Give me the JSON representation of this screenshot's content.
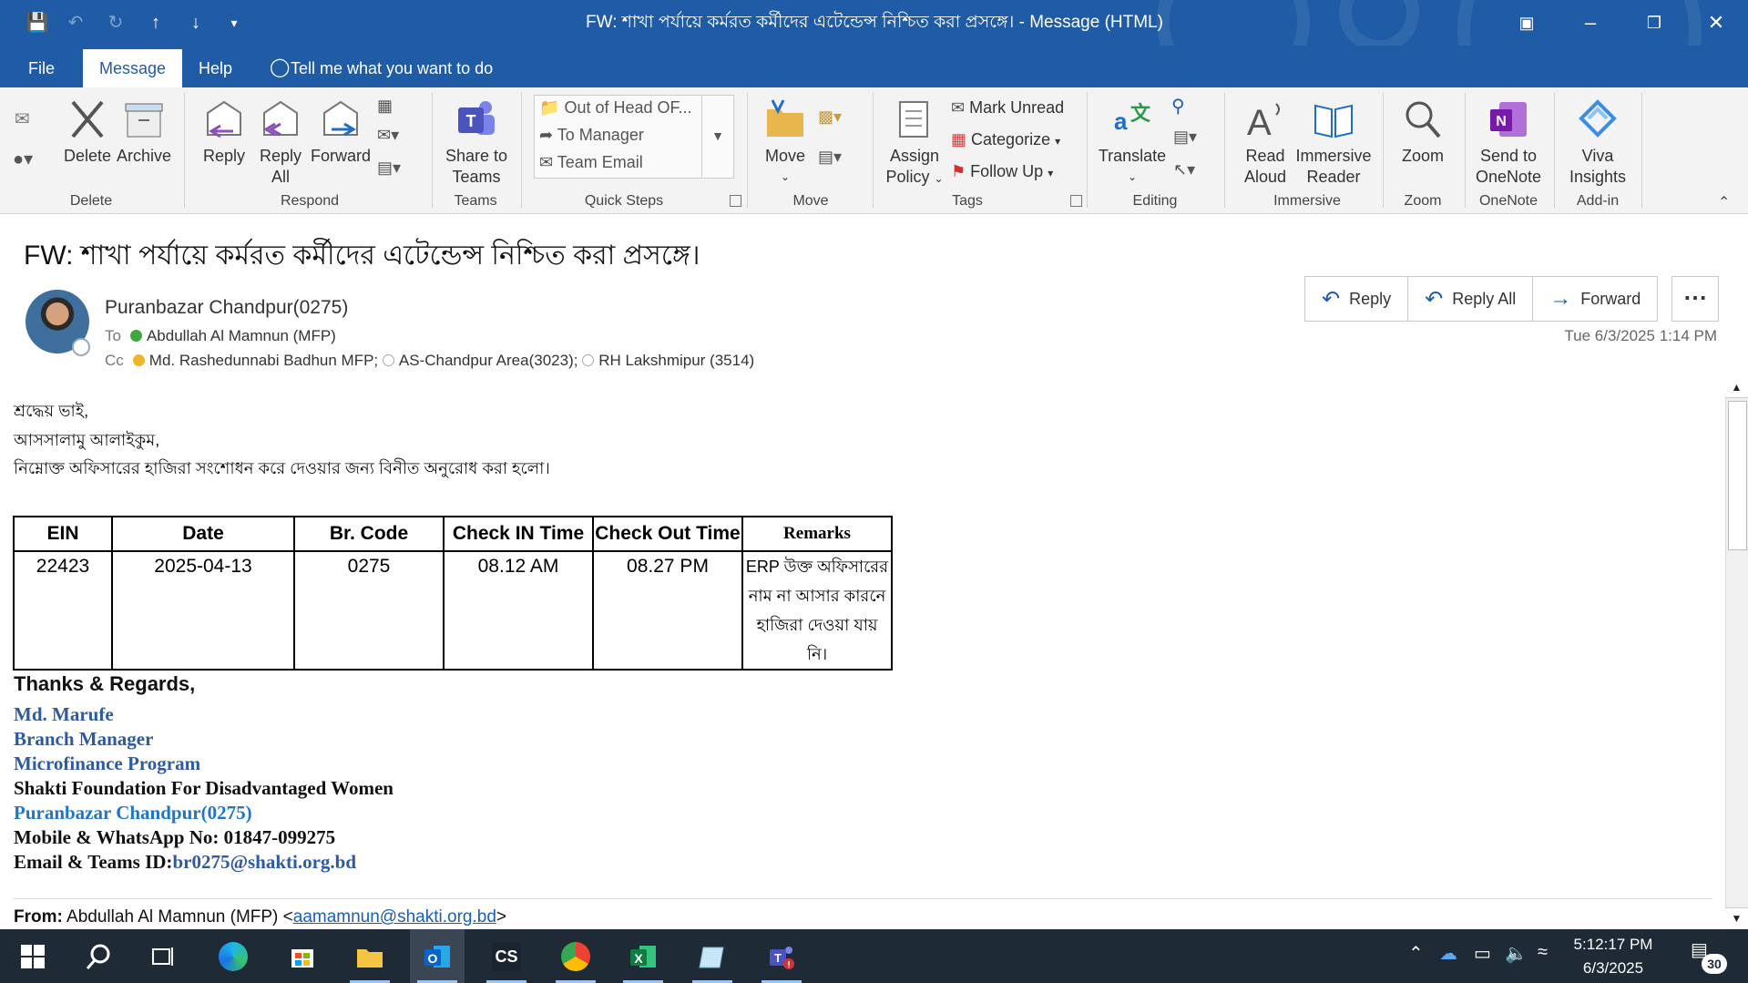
{
  "window": {
    "title": "FW: শাখা পর্যায়ে কর্মরত কর্মীদের এটেন্ডেন্স নিশ্চিত করা প্রসঙ্গে।  -  Message (HTML)",
    "quick_access": [
      "save-icon",
      "undo-icon",
      "redo-icon",
      "up-arrow-icon",
      "down-arrow-icon",
      "customize-icon"
    ]
  },
  "menu": {
    "file": "File",
    "message": "Message",
    "help": "Help",
    "tell_me": "Tell me what you want to do"
  },
  "ribbon": {
    "groups": {
      "delete": "Delete",
      "respond": "Respond",
      "teams": "Teams",
      "quick_steps": "Quick Steps",
      "move": "Move",
      "tags": "Tags",
      "editing": "Editing",
      "immersive": "Immersive",
      "zoom": "Zoom",
      "onenote": "OneNote",
      "addin": "Add-in"
    },
    "delete": "Delete",
    "archive": "Archive",
    "reply": "Reply",
    "reply_all_1": "Reply",
    "reply_all_2": "All",
    "forward": "Forward",
    "share_teams_1": "Share to",
    "share_teams_2": "Teams",
    "quick_steps": [
      "Out of Head OF...",
      "To Manager",
      "Team Email"
    ],
    "move": "Move",
    "assign_1": "Assign",
    "assign_2": "Policy",
    "mark_unread": "Mark Unread",
    "categorize": "Categorize",
    "follow_up": "Follow Up",
    "translate": "Translate",
    "read_aloud_1": "Read",
    "read_aloud_2": "Aloud",
    "immersive_1": "Immersive",
    "immersive_2": "Reader",
    "zoom": "Zoom",
    "onenote_1": "Send to",
    "onenote_2": "OneNote",
    "viva_1": "Viva",
    "viva_2": "Insights"
  },
  "message": {
    "subject": "FW: শাখা পর্যায়ে কর্মরত কর্মীদের এটেন্ডেন্স নিশ্চিত করা প্রসঙ্গে।",
    "sender": "Puranbazar Chandpur(0275)",
    "to_label": "To",
    "to": "Abdullah Al Mamnun (MFP)",
    "cc_label": "Cc",
    "cc": [
      "Md. Rashedunnabi Badhun MFP;",
      "AS-Chandpur Area(3023);",
      "RH Lakshmipur (3514)"
    ],
    "date": "Tue 6/3/2025 1:14 PM",
    "actions": {
      "reply": "Reply",
      "reply_all": "Reply All",
      "forward": "Forward"
    }
  },
  "body": {
    "greeting": "শ্রদ্ধেয় ভাই,",
    "salam": "আসসালামু আলাইকুম,",
    "request": "নিম্নোক্ত অফিসারের হাজিরা সংশোধন করে দেওয়ার জন্য বিনীত অনুরোধ করা হলো।",
    "table": {
      "headers": [
        "EIN",
        "Date",
        "Br. Code",
        "Check IN Time",
        "Check Out Time",
        "Remarks"
      ],
      "row": {
        "ein": "22423",
        "date": "2025-04-13",
        "br_code": "0275",
        "check_in": "08.12 AM",
        "check_out": "08.27 PM",
        "remarks_1": "ERP উক্ত অফিসারের",
        "remarks_2": "নাম না আসার কারনে",
        "remarks_3": "হাজিরা দেওয়া যায় নি।"
      }
    },
    "signature": {
      "thanks": "Thanks & Regards,",
      "name": "Md. Marufe",
      "designation": "Branch Manager",
      "program": "Microfinance Program",
      "org": "Shakti Foundation For Disadvantaged Women",
      "branch": "Puranbazar Chandpur(0275)",
      "mobile": "Mobile & WhatsApp No: 01847-099275",
      "email_label": "Email & Teams ID:",
      "email": "br0275@shakti.org.bd"
    },
    "forward_from_label": "From:",
    "forward_from_name": " Abdullah Al Mamnun (MFP) <",
    "forward_from_email": "aamamnun@shakti.org.bd",
    "forward_from_end": ">"
  },
  "taskbar": {
    "apps": [
      "windows-start-icon",
      "search-icon",
      "task-view-icon",
      "edge-icon",
      "store-icon",
      "file-explorer-icon",
      "outlook-icon",
      "cs-app-icon",
      "chrome-icon",
      "excel-icon",
      "notepad-icon",
      "teams-icon"
    ],
    "cs_label": "CS",
    "time": "5:12:17 PM",
    "date": "6/3/2025",
    "notifications": "30"
  }
}
